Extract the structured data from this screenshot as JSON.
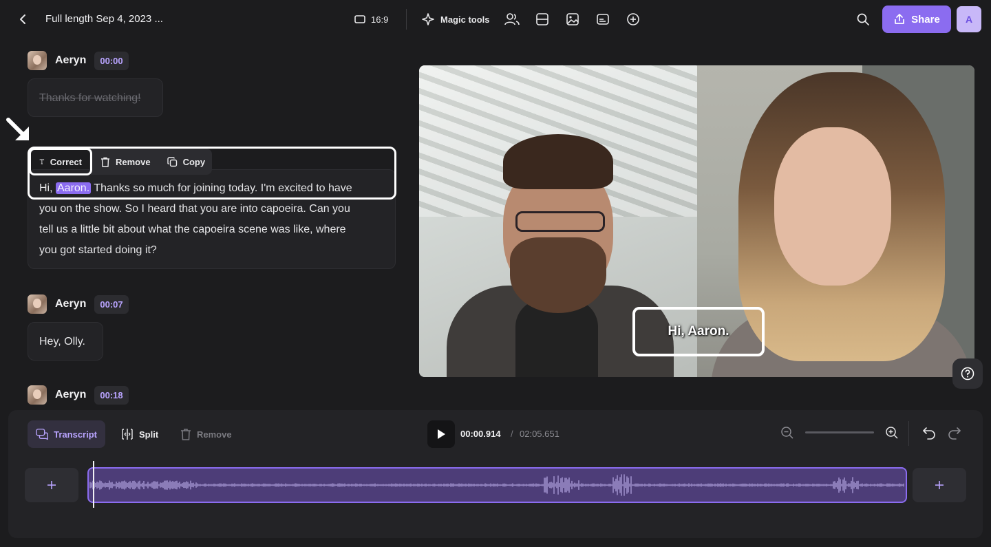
{
  "header": {
    "title": "Full length Sep 4, 2023 ...",
    "aspect_ratio": "16:9",
    "magic_tools_label": "Magic tools",
    "share_label": "Share",
    "avatar_initial": "A",
    "accent_color": "#8b6cf0"
  },
  "transcript": {
    "segments": [
      {
        "speaker": "Aeryn",
        "time": "00:00",
        "text": "Thanks for watching!",
        "removed": true
      },
      {
        "text_before": "Hi, ",
        "highlight": "Aaron.",
        "text_after": " Thanks so much for joining today. I'm excited to have",
        "line2": "you on the show. So I heard that you are into capoeira. Can you",
        "line3": "tell us a little bit about what the capoeira scene was like, where",
        "line4": "you got started doing it?"
      },
      {
        "speaker": "Aeryn",
        "time": "00:07",
        "text": "Hey, Olly."
      },
      {
        "speaker": "Aeryn",
        "time": "00:18"
      }
    ],
    "context_menu": {
      "correct": "Correct",
      "remove": "Remove",
      "copy": "Copy"
    }
  },
  "video": {
    "caption": "Hi, Aaron."
  },
  "timeline": {
    "transcript_label": "Transcript",
    "split_label": "Split",
    "remove_label": "Remove",
    "current_time": "00:00.914",
    "separator": "/",
    "total_time": "02:05.651"
  }
}
